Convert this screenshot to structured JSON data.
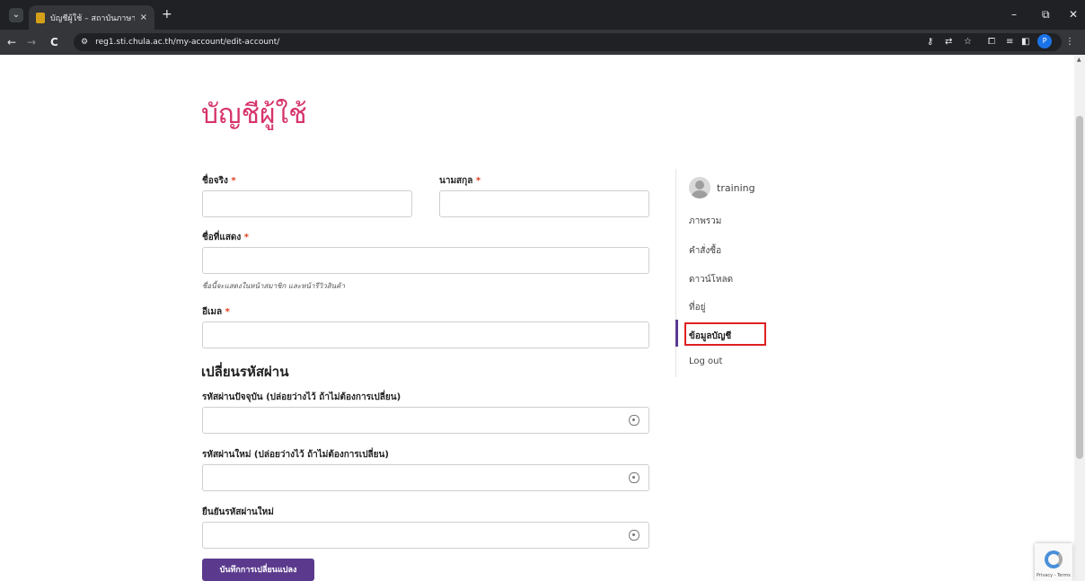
{
  "browser": {
    "tab_title": "บัญชีผู้ใช้ – สถาบันภาษาไทยสิรินธร",
    "tab_close": "×",
    "new_tab": "+",
    "url": "reg1.sti.chula.ac.th/my-account/edit-account/",
    "window_controls": {
      "minimize": "–",
      "restore": "⧉",
      "close": "✕"
    },
    "nav": {
      "back": "←",
      "forward": "→",
      "reload": "C"
    },
    "profile_initial": "P"
  },
  "page": {
    "title": "บัญชีผู้ใช้"
  },
  "form": {
    "required_mark": "*",
    "first_name": {
      "label": "ชื่อจริง",
      "value": ""
    },
    "last_name": {
      "label": "นามสกุล",
      "value": ""
    },
    "display_name": {
      "label": "ชื่อที่แสดง",
      "value": "",
      "hint": "ชื่อนี้จะแสดงในหน้าสมาชิก และหน้ารีวิวสินค้า"
    },
    "email": {
      "label": "อีเมล",
      "value": ""
    },
    "password_section_title": "เปลี่ยนรหัสผ่าน",
    "current_password": {
      "label": "รหัสผ่านปัจจุบัน (ปล่อยว่างไว้ ถ้าไม่ต้องการเปลี่ยน)",
      "value": ""
    },
    "new_password": {
      "label": "รหัสผ่านใหม่ (ปล่อยว่างไว้ ถ้าไม่ต้องการเปลี่ยน)",
      "value": ""
    },
    "confirm_password": {
      "label": "ยืนยันรหัสผ่านใหม่",
      "value": ""
    },
    "save_label": "บันทึกการเปลี่ยนแปลง"
  },
  "account_nav": {
    "username": "training",
    "items": [
      {
        "label": "ภาพรวม"
      },
      {
        "label": "คำสั่งซื้อ"
      },
      {
        "label": "ดาวน์โหลด"
      },
      {
        "label": "ที่อยู่"
      },
      {
        "label": "ข้อมูลบัญชี",
        "active": true
      },
      {
        "label": "Log out"
      }
    ]
  },
  "recaptcha": {
    "terms": "Privacy - Terms"
  },
  "colors": {
    "accent": "#5b3a8e",
    "title": "#d6336c",
    "highlight": "#e02020"
  }
}
